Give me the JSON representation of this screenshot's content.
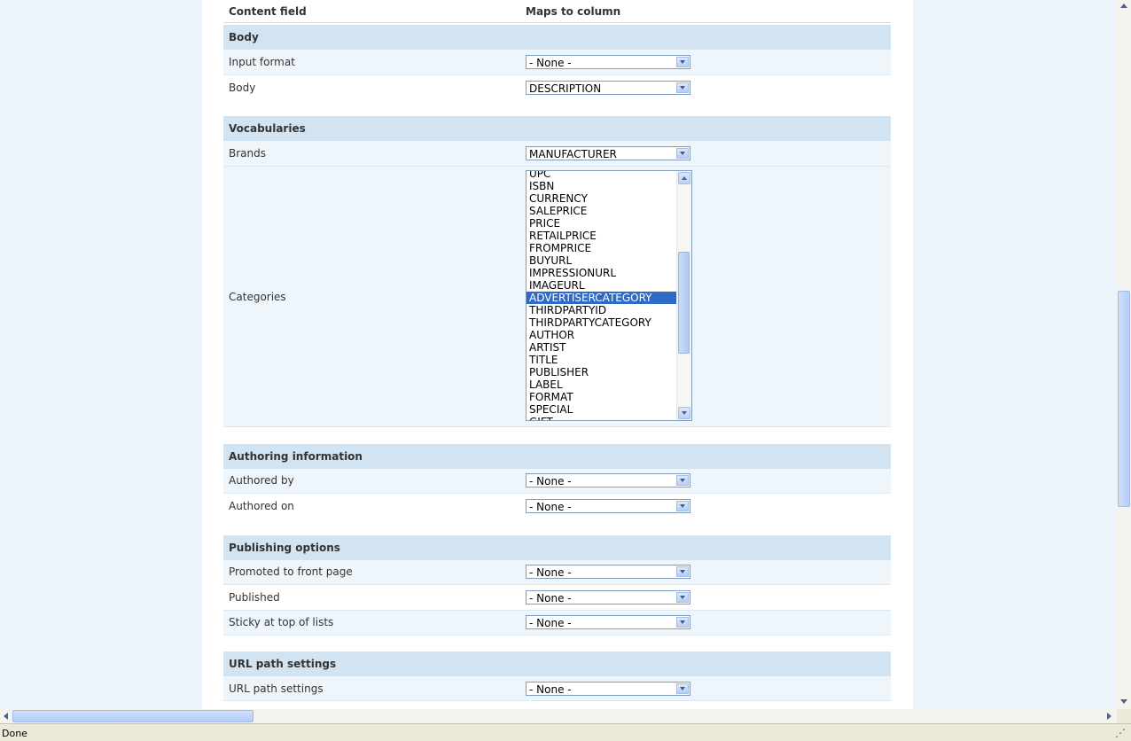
{
  "table": {
    "header": {
      "field": "Content field",
      "column": "Maps to column"
    },
    "sections": {
      "body": {
        "title": "Body",
        "input_format": {
          "label": "Input format",
          "value": "- None -"
        },
        "body": {
          "label": "Body",
          "value": "DESCRIPTION"
        }
      },
      "vocabularies": {
        "title": "Vocabularies",
        "brands": {
          "label": "Brands",
          "value": "MANUFACTURER"
        },
        "categories": {
          "label": "Categories",
          "options": [
            "UPC",
            "ISBN",
            "CURRENCY",
            "SALEPRICE",
            "PRICE",
            "RETAILPRICE",
            "FROMPRICE",
            "BUYURL",
            "IMPRESSIONURL",
            "IMAGEURL",
            "ADVERTISERCATEGORY",
            "THIRDPARTYID",
            "THIRDPARTYCATEGORY",
            "AUTHOR",
            "ARTIST",
            "TITLE",
            "PUBLISHER",
            "LABEL",
            "FORMAT",
            "SPECIAL",
            "GIFT"
          ],
          "selected": "ADVERTISERCATEGORY"
        }
      },
      "authoring": {
        "title": "Authoring information",
        "authored_by": {
          "label": "Authored by",
          "value": "- None -"
        },
        "authored_on": {
          "label": "Authored on",
          "value": "- None -"
        }
      },
      "publishing": {
        "title": "Publishing options",
        "promoted": {
          "label": "Promoted to front page",
          "value": "- None -"
        },
        "published": {
          "label": "Published",
          "value": "- None -"
        },
        "sticky": {
          "label": "Sticky at top of lists",
          "value": "- None -"
        }
      },
      "url": {
        "title": "URL path settings",
        "url_path": {
          "label": "URL path settings",
          "value": "- None -"
        }
      }
    }
  },
  "status": {
    "text": "Done"
  },
  "colors": {
    "section_header": "#d2e3f1",
    "odd_row": "#eef5fb",
    "selection": "#316ac5",
    "page_bg": "#edf3fa"
  }
}
